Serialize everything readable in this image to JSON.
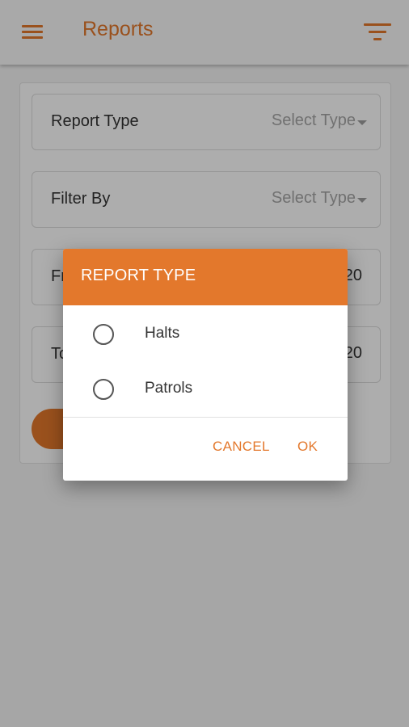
{
  "app_bar": {
    "title": "Reports",
    "menu_icon": "hamburger-menu-icon",
    "filter_icon": "filter-icon",
    "accent_color": "#e3782c"
  },
  "form": {
    "report_type": {
      "label": "Report Type",
      "value": "Select Type"
    },
    "filter_by": {
      "label": "Filter By",
      "value": "Select Type"
    },
    "from": {
      "label_partial": "Fr",
      "value_partial": "20"
    },
    "to": {
      "label_partial": "To",
      "value_partial": "20"
    }
  },
  "dialog": {
    "title": "REPORT TYPE",
    "options": [
      {
        "label": "Halts",
        "selected": false
      },
      {
        "label": "Patrols",
        "selected": false
      }
    ],
    "cancel_label": "CANCEL",
    "ok_label": "OK"
  }
}
